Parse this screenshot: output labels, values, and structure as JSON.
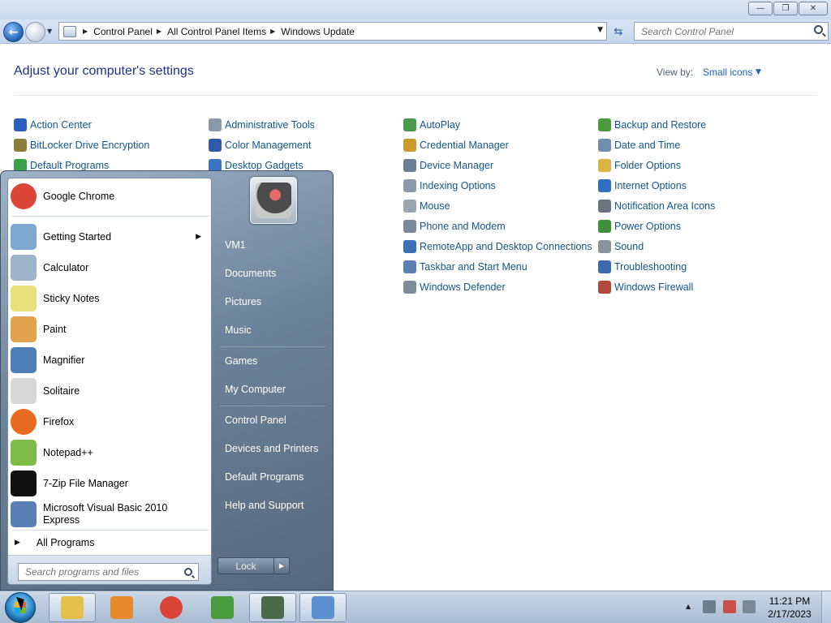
{
  "window": {
    "caption": {
      "minimize": "—",
      "maximize": "❐",
      "close": "✕"
    },
    "breadcrumb": [
      "Control Panel",
      "All Control Panel Items",
      "Windows Update"
    ],
    "search_placeholder": "Search Control Panel"
  },
  "content": {
    "title": "Adjust your computer's settings",
    "view_by_label": "View by:",
    "view_by_value": "Small icons",
    "columns": [
      [
        {
          "label": "Action Center",
          "color": "#2c5fbf"
        },
        {
          "label": "BitLocker Drive Encryption",
          "color": "#8b7d3a"
        },
        {
          "label": "Default Programs",
          "color": "#3aa24a"
        }
      ],
      [
        {
          "label": "Administrative Tools",
          "color": "#8899aa"
        },
        {
          "label": "Color Management",
          "color": "#2e5aa8"
        },
        {
          "label": "Desktop Gadgets",
          "color": "#3a74c4"
        }
      ],
      [
        {
          "label": "AutoPlay",
          "color": "#4a9a4a"
        },
        {
          "label": "Credential Manager",
          "color": "#c89b2a"
        },
        {
          "label": "Device Manager",
          "color": "#6b7f96"
        },
        {
          "label": "Indexing Options",
          "color": "#8a9aab"
        },
        {
          "label": "Mouse",
          "color": "#9aa6b2"
        },
        {
          "label": "Phone and Modem",
          "color": "#7a8a9a"
        },
        {
          "label": "RemoteApp and Desktop Connections",
          "color": "#3b6fb6"
        },
        {
          "label": "Taskbar and Start Menu",
          "color": "#5a7fb0"
        },
        {
          "label": "Windows Defender",
          "color": "#7d8c9b"
        }
      ],
      [
        {
          "label": "Backup and Restore",
          "color": "#4d9a3e"
        },
        {
          "label": "Date and Time",
          "color": "#6f8faf"
        },
        {
          "label": "Folder Options",
          "color": "#d8b645"
        },
        {
          "label": "Internet Options",
          "color": "#2f6ec0"
        },
        {
          "label": "Notification Area Icons",
          "color": "#6a7480"
        },
        {
          "label": "Power Options",
          "color": "#3f8f3a"
        },
        {
          "label": "Sound",
          "color": "#8a94a0"
        },
        {
          "label": "Troubleshooting",
          "color": "#3a6ab0"
        },
        {
          "label": "Windows Firewall",
          "color": "#b04a3a"
        }
      ]
    ]
  },
  "start_menu": {
    "pinned": {
      "label": "Google Chrome",
      "icon": "chrome-icon",
      "color": "#db4437"
    },
    "recent": [
      {
        "label": "Getting Started",
        "icon": "getting-started-icon",
        "color": "#7fa8d0",
        "submenu": true
      },
      {
        "label": "Calculator",
        "icon": "calculator-icon",
        "color": "#9db3c8"
      },
      {
        "label": "Sticky Notes",
        "icon": "sticky-notes-icon",
        "color": "#e9e27a"
      },
      {
        "label": "Paint",
        "icon": "paint-icon",
        "color": "#e3a34a"
      },
      {
        "label": "Magnifier",
        "icon": "magnifier-icon",
        "color": "#4f7fb8"
      },
      {
        "label": "Solitaire",
        "icon": "solitaire-icon",
        "color": "#d8d8d8"
      },
      {
        "label": "Firefox",
        "icon": "firefox-icon",
        "color": "#e66a1f"
      },
      {
        "label": "Notepad++",
        "icon": "notepadpp-icon",
        "color": "#7cbc47"
      },
      {
        "label": "7-Zip File Manager",
        "icon": "7zip-icon",
        "color": "#111111"
      },
      {
        "label": "Microsoft Visual Basic 2010 Express",
        "icon": "visual-basic-icon",
        "color": "#5a7fb5"
      }
    ],
    "all_programs": "All Programs",
    "search_placeholder": "Search programs and files",
    "right": {
      "user": "VM1",
      "links_group1": [
        "Documents",
        "Pictures",
        "Music"
      ],
      "links_group2": [
        "Games",
        "My Computer"
      ],
      "links_group3": [
        "Control Panel",
        "Devices and Printers",
        "Default Programs",
        "Help and Support"
      ]
    },
    "lock_label": "Lock"
  },
  "taskbar": {
    "apps": [
      {
        "name": "explorer-icon",
        "color": "#e5c04d"
      },
      {
        "name": "media-player-icon",
        "color": "#e68a2e"
      },
      {
        "name": "chrome-icon",
        "color": "#db4437"
      },
      {
        "name": "csharp-express-icon",
        "color": "#4a9a3e"
      },
      {
        "name": "task-manager-icon",
        "color": "#4a6a4a"
      },
      {
        "name": "control-panel-icon",
        "color": "#5c8fd0"
      }
    ],
    "time": "11:21 PM",
    "date": "2/17/2023"
  }
}
